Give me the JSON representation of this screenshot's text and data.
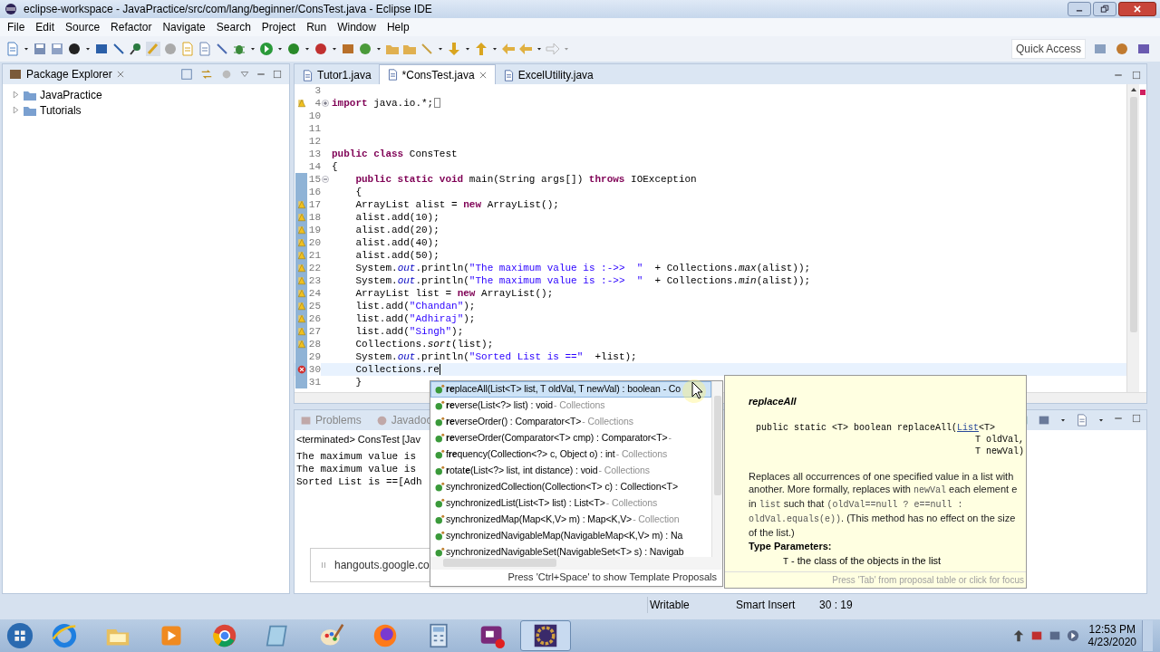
{
  "window": {
    "title": "eclipse-workspace - JavaPractice/src/com/lang/beginner/ConsTest.java - Eclipse IDE"
  },
  "menu": [
    "File",
    "Edit",
    "Source",
    "Refactor",
    "Navigate",
    "Search",
    "Project",
    "Run",
    "Window",
    "Help"
  ],
  "quick_access": "Quick Access",
  "package_explorer": {
    "title": "Package Explorer",
    "items": [
      {
        "label": "JavaPractice",
        "expanded": false
      },
      {
        "label": "Tutorials",
        "expanded": false
      }
    ]
  },
  "editor": {
    "tabs": [
      {
        "label": "Tutor1.java",
        "selected": false
      },
      {
        "label": "*ConsTest.java",
        "selected": true
      },
      {
        "label": "ExcelUtility.java",
        "selected": false
      }
    ],
    "lines": [
      {
        "number": "3",
        "kind": "plain",
        "changed": false,
        "current": false
      },
      {
        "number": "4",
        "kind": "warning",
        "expanded": false,
        "changed": false,
        "current": false,
        "tokens": [
          {
            "kind": "keyword",
            "text": "import"
          },
          {
            "kind": "plain",
            "text": " java.io.*;"
          },
          {
            "kind": "folded"
          }
        ]
      },
      {
        "number": "10",
        "kind": "plain",
        "changed": false,
        "current": false
      },
      {
        "number": "11",
        "kind": "plain",
        "changed": false,
        "current": false
      },
      {
        "number": "12",
        "kind": "plain",
        "changed": false,
        "current": false
      },
      {
        "number": "13",
        "kind": "plain",
        "changed": false,
        "current": false,
        "tokens": [
          {
            "kind": "keyword",
            "text": "public class"
          },
          {
            "kind": "plain",
            "text": " ConsTest"
          }
        ]
      },
      {
        "number": "14",
        "kind": "plain",
        "changed": false,
        "current": false,
        "tokens": [
          {
            "kind": "plain",
            "text": "{"
          }
        ]
      },
      {
        "number": "15",
        "kind": "plain",
        "expanded": true,
        "changed": true,
        "current": false,
        "tokens": [
          {
            "kind": "keyword",
            "text": "    public static void"
          },
          {
            "kind": "plain",
            "text": " main(String args[]) "
          },
          {
            "kind": "keyword",
            "text": "throws"
          },
          {
            "kind": "plain",
            "text": " IOException"
          }
        ]
      },
      {
        "number": "16",
        "kind": "plain",
        "changed": true,
        "current": false,
        "tokens": [
          {
            "kind": "plain",
            "text": "    {"
          }
        ]
      },
      {
        "number": "17",
        "kind": "warning",
        "changed": true,
        "current": false,
        "tokens": [
          {
            "kind": "plain",
            "text": "    ArrayList alist = "
          },
          {
            "kind": "keyword",
            "text": "new"
          },
          {
            "kind": "plain",
            "text": " ArrayList();"
          }
        ]
      },
      {
        "number": "18",
        "kind": "warning",
        "changed": true,
        "current": false,
        "tokens": [
          {
            "kind": "plain",
            "text": "    alist.add(10);"
          }
        ]
      },
      {
        "number": "19",
        "kind": "warning",
        "changed": true,
        "current": false,
        "tokens": [
          {
            "kind": "plain",
            "text": "    alist.add(20);"
          }
        ]
      },
      {
        "number": "20",
        "kind": "warning",
        "changed": true,
        "current": false,
        "tokens": [
          {
            "kind": "plain",
            "text": "    alist.add(40);"
          }
        ]
      },
      {
        "number": "21",
        "kind": "warning",
        "changed": true,
        "current": false,
        "tokens": [
          {
            "kind": "plain",
            "text": "    alist.add(50);"
          }
        ]
      },
      {
        "number": "22",
        "kind": "warning",
        "changed": true,
        "current": false,
        "tokens": [
          {
            "kind": "plain",
            "text": "    System."
          },
          {
            "kind": "field",
            "text": "out"
          },
          {
            "kind": "plain",
            "text": ".println("
          },
          {
            "kind": "string",
            "text": "\"The maximum value is :->>  \""
          },
          {
            "kind": "plain",
            "text": "  + Collections."
          },
          {
            "kind": "static",
            "text": "max"
          },
          {
            "kind": "plain",
            "text": "(alist));"
          }
        ]
      },
      {
        "number": "23",
        "kind": "warning",
        "changed": true,
        "current": false,
        "tokens": [
          {
            "kind": "plain",
            "text": "    System."
          },
          {
            "kind": "field",
            "text": "out"
          },
          {
            "kind": "plain",
            "text": ".println("
          },
          {
            "kind": "string",
            "text": "\"The maximum value is :->>  \""
          },
          {
            "kind": "plain",
            "text": "  + Collections."
          },
          {
            "kind": "static",
            "text": "min"
          },
          {
            "kind": "plain",
            "text": "(alist));"
          }
        ]
      },
      {
        "number": "24",
        "kind": "warning",
        "changed": true,
        "current": false,
        "tokens": [
          {
            "kind": "plain",
            "text": "    ArrayList list = "
          },
          {
            "kind": "keyword",
            "text": "new"
          },
          {
            "kind": "plain",
            "text": " ArrayList();"
          }
        ]
      },
      {
        "number": "25",
        "kind": "warning",
        "changed": true,
        "current": false,
        "tokens": [
          {
            "kind": "plain",
            "text": "    list.add("
          },
          {
            "kind": "string",
            "text": "\"Chandan\""
          },
          {
            "kind": "plain",
            "text": ");"
          }
        ]
      },
      {
        "number": "26",
        "kind": "warning",
        "changed": true,
        "current": false,
        "tokens": [
          {
            "kind": "plain",
            "text": "    list.add("
          },
          {
            "kind": "string",
            "text": "\"Adhiraj\""
          },
          {
            "kind": "plain",
            "text": ");"
          }
        ]
      },
      {
        "number": "27",
        "kind": "warning",
        "changed": true,
        "current": false,
        "tokens": [
          {
            "kind": "plain",
            "text": "    list.add("
          },
          {
            "kind": "string",
            "text": "\"Singh\""
          },
          {
            "kind": "plain",
            "text": ");"
          }
        ]
      },
      {
        "number": "28",
        "kind": "warning",
        "changed": true,
        "current": false,
        "tokens": [
          {
            "kind": "plain",
            "text": "    Collections."
          },
          {
            "kind": "static",
            "text": "sort"
          },
          {
            "kind": "plain",
            "text": "(list);"
          }
        ]
      },
      {
        "number": "29",
        "kind": "plain",
        "changed": true,
        "current": false,
        "tokens": [
          {
            "kind": "plain",
            "text": "    System."
          },
          {
            "kind": "field",
            "text": "out"
          },
          {
            "kind": "plain",
            "text": ".println("
          },
          {
            "kind": "string",
            "text": "\"Sorted List is ==\""
          },
          {
            "kind": "plain",
            "text": "  +list);"
          }
        ]
      },
      {
        "number": "30",
        "kind": "error",
        "changed": true,
        "current": true,
        "tokens": [
          {
            "kind": "plain",
            "text": "    Collections.re"
          },
          {
            "kind": "caret"
          }
        ]
      },
      {
        "number": "31",
        "kind": "plain",
        "changed": true,
        "current": false,
        "tokens": [
          {
            "kind": "plain",
            "text": "    }"
          }
        ]
      }
    ]
  },
  "bottom_panel": {
    "tabs": [
      {
        "label": "Problems",
        "selected": false
      },
      {
        "label": "Javadoc",
        "selected": false
      }
    ],
    "console_header": "<terminated> ConsTest [Jav",
    "console_lines": [
      "The maximum value is",
      "The maximum value is",
      "Sorted List is ==[Adh"
    ]
  },
  "notification": {
    "text": "hangouts.google.co"
  },
  "completion": {
    "items": [
      {
        "signature": "**re**placeAll(List<T> list, T oldVal, T newVal) : boolean - Co",
        "selected": true
      },
      {
        "signature": "**re**verse(List<?> list) : void",
        "owner": " - Collections",
        "selected": false
      },
      {
        "signature": "**re**verseOrder() : Comparator<T>",
        "owner": " - Collections",
        "selected": false
      },
      {
        "signature": "**re**verseOrder(Comparator<T> cmp) : Comparator<T>",
        "owner": " -",
        "selected": false
      },
      {
        "signature": "f**re**quency(Collection<?> c, Object o) : int",
        "owner": " - Collections",
        "selected": false
      },
      {
        "signature": "**r**otat**e**(List<?> list, int distance) : void",
        "owner": " - Collections",
        "selected": false
      },
      {
        "signature": "synchronizedCollection(Collection<T> c) : Collection<T>",
        "selected": false
      },
      {
        "signature": "synchronizedList(List<T> list) : List<T>",
        "owner": " - Collections",
        "selected": false
      },
      {
        "signature": "synchronizedMap(Map<K,V> m) : Map<K,V>",
        "owner": " - Collection",
        "selected": false
      },
      {
        "signature": "synchronizedNavigableMap(NavigableMap<K,V> m) : Na",
        "selected": false
      },
      {
        "signature": "synchronizedNavigableSet(NavigableSet<T> s) : Navigab",
        "selected": false
      }
    ],
    "footer": "Press 'Ctrl+Space' to show Template Proposals"
  },
  "javadoc": {
    "title": "replaceAll",
    "signature_lines": [
      {
        "prefix": "public static <T> boolean replaceAll(",
        "link": "List",
        "suffix": "<T>"
      },
      {
        "prefix": "T oldVal,"
      },
      {
        "prefix": "T newVal)"
      }
    ],
    "description": [
      {
        "kind": "text",
        "text": "Replaces all occurrences of one specified value in a list with another. More formally, replaces with "
      },
      {
        "kind": "code",
        "text": "newVal"
      },
      {
        "kind": "text",
        "text": " each element e in "
      },
      {
        "kind": "code",
        "text": "list"
      },
      {
        "kind": "text",
        "text": " such that "
      },
      {
        "kind": "code",
        "text": "(oldVal==null ? e==null : oldVal.equals(e))"
      },
      {
        "kind": "text",
        "text": ". (This method has no effect on the size of the list.)"
      }
    ],
    "type_parameters_heading": "Type Parameters:",
    "type_parameter": {
      "name": "T",
      "text": " - the class of the objects in the list"
    },
    "footer": "Press 'Tab' from proposal table or click for focus"
  },
  "status_bar": {
    "mode": "Writable",
    "insert": "Smart Insert",
    "position": "30 : 19"
  },
  "taskbar": {
    "apps": [
      {
        "kind": "ie",
        "active": false
      },
      {
        "kind": "explorer",
        "active": false
      },
      {
        "kind": "media",
        "active": false
      },
      {
        "kind": "chrome",
        "active": false
      },
      {
        "kind": "notepad",
        "active": false
      },
      {
        "kind": "paint",
        "active": false
      },
      {
        "kind": "firefox",
        "active": false
      },
      {
        "kind": "calculator",
        "active": false
      },
      {
        "kind": "recorder",
        "active": false
      },
      {
        "kind": "eclipse",
        "active": true
      }
    ],
    "time": "12:53 PM",
    "date": "4/23/2020"
  }
}
